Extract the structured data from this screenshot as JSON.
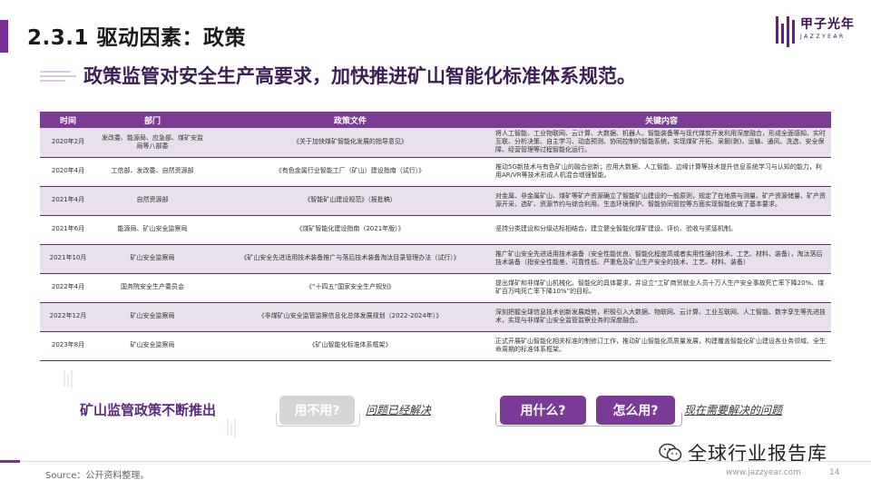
{
  "section_title": "2.3.1 驱动因素：政策",
  "logo": {
    "cn": "甲子光年",
    "en": "JAZZYEAR"
  },
  "headline": "政策监管对安全生产高要求，加快推进矿山智能化标准体系规范。",
  "table": {
    "headers": [
      "时间",
      "部门",
      "政策文件",
      "关键内容"
    ],
    "rows": [
      {
        "time": "2020年2月",
        "dept": "发改委、能源局、应急部、煤矿安监局等八部委",
        "doc": "《关于加快煤矿智能化发展的指导意见》",
        "key": "将人工智能、工业物联网、云计算、大数据、机器人、智能装备等与现代煤炭开发利用深度融合，形成全面感知、实时互联、分析决策、自主学习、动态预测、协同控制的智能系统，实现煤矿开拓、采掘(剥)、运输、通风、洗选、安全保障、经营管理等过程智能化运行。"
      },
      {
        "time": "2020年4月",
        "dept": "工信部、发改委、自然资源部",
        "doc": "《有色金属行业智能工厂（矿山）建设指南（试行）》",
        "key": "推动5G新技术与有色矿山的融合创新；应用大数据、人工智能、边缘计算等技术提升信息系统学习与认知的能力，利用AR/VR等技术形成人机混合增强智能。"
      },
      {
        "time": "2021年4月",
        "dept": "自然资源部",
        "doc": "《智能矿山建设规范》（报批稿）",
        "key": "对金属、非金属矿山、煤矿等矿产资源确立了智能矿山建设的一般原则，规定了在地质与测量、矿产资源储量、矿产资源开采、选矿、资源节约与综合利用、生态环境保护、智能协同管控等方面实现智能化做了基本要求。"
      },
      {
        "time": "2021年6月",
        "dept": "能源局、矿山安全监察局",
        "doc": "《煤矿智能化建设指南（2021年版）》",
        "key": "坚持分类建设和分级达标相结合，建立健全智能化煤矿建设、评价、验收与奖惩机制。"
      },
      {
        "time": "2021年10月",
        "dept": "矿山安全监察局",
        "doc": "《矿山安全先进适用技术装备推广与落后技术装备淘汰目录管理办法（试行）》",
        "key": "推广矿山安全先进适用技术装备（安全性能优良、智能化程度高或者实用性强的技术、工艺、材料、装备），淘汰落后技术装备（指安全性能差、可靠性低、严重危及矿山生产安全的技术、工艺、材料、装备）"
      },
      {
        "time": "2022年4月",
        "dept": "国务院安全生产委员会",
        "doc": "《“十四五”国家安全生产规划》",
        "key": "提出煤矿和非煤矿山机械化、智能化的具体要求，并设立“工矿商贸就业人员十万人生产安全事故死亡率下降20%、煤矿百万吨死亡率下降10%”的目标。"
      },
      {
        "time": "2022年12月",
        "dept": "矿山安全监察局",
        "doc": "《非煤矿山安全监管监察信息化总体发展规划（2022-2024年）》",
        "key": "深刻把握全球信息技术创新发展趋势，积极引入大数据、物联网、云计算、工业互联网、人工智能、数字孪生等先进技术，实现与非煤矿山安全监管监察业务的深度融合。"
      },
      {
        "time": "2023年8月",
        "dept": "矿山安全监察局",
        "doc": "《矿山智能化标准体系框架》",
        "key": "正式开展矿山智能化相关标准的制修订工作，推动矿山智能化高质量发展，构建覆盖智能化矿山建设各业务领域、全生命周期的标准体系框架。"
      }
    ]
  },
  "bottom": {
    "left_label": "矿山监管政策不断推出",
    "pill_gray": "用不用?",
    "note1": "问题已经解决",
    "pill_what": "用什么?",
    "pill_how": "怎么用?",
    "note2": "现在需要解决的问题"
  },
  "footer": {
    "source": "Source：公开资料整理。",
    "url": "www.jazzyear.com",
    "page": "14",
    "watermark": "全球行业报告库"
  },
  "colors": {
    "accent": "#7a2e9c",
    "header": "#7a3c95",
    "band": "#e8e1eb",
    "gray_pill": "#d6d6d6"
  }
}
